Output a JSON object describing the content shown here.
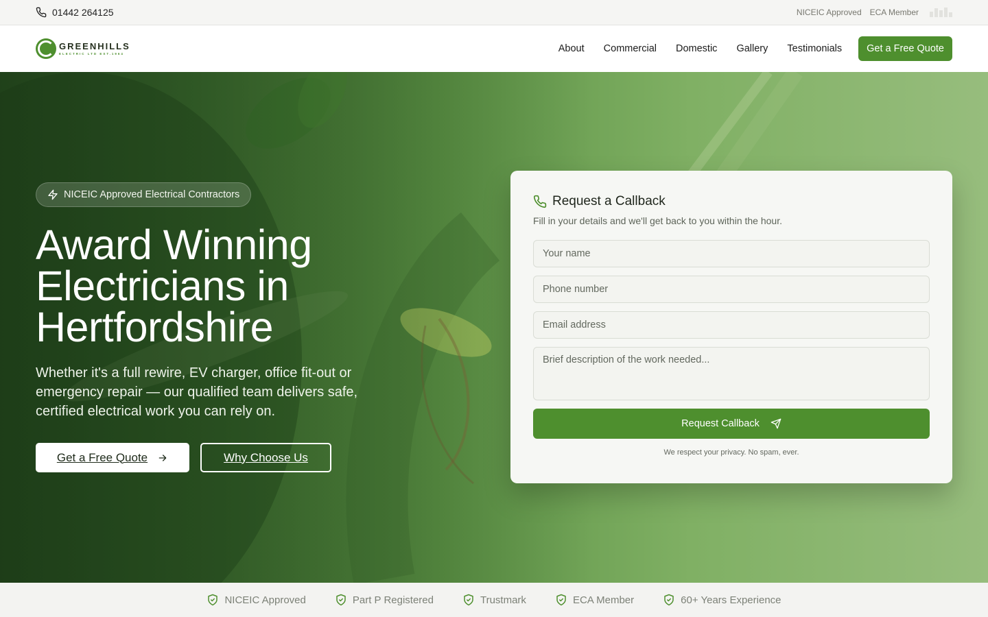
{
  "topbar": {
    "phone": "01442 264125",
    "badges": [
      "NICEIC Approved",
      "ECA Member"
    ]
  },
  "header": {
    "logo_name": "GREENHILLS",
    "logo_sub": "ELECTRIC LTD EST.1964",
    "nav": [
      "About",
      "Commercial",
      "Domestic",
      "Gallery",
      "Testimonials"
    ],
    "cta": "Get a Free Quote"
  },
  "hero": {
    "badge": "NICEIC Approved Electrical Contractors",
    "title_lines": [
      "Award Winning",
      "Electricians in",
      "Hertfordshire"
    ],
    "subtitle": "Whether it's a full rewire, EV charger, office fit-out or emergency repair — our qualified team delivers safe, certified electrical work you can rely on.",
    "primary_button": "Get a Free Quote",
    "secondary_button": "Why Choose Us"
  },
  "callback": {
    "title": "Request a Callback",
    "description": "Fill in your details and we'll get back to you within the hour.",
    "name_placeholder": "Your name",
    "phone_placeholder": "Phone number",
    "email_placeholder": "Email address",
    "message_placeholder": "Brief description of the work needed...",
    "submit": "Request Callback",
    "privacy": "We respect your privacy. No spam, ever."
  },
  "trust": [
    "NICEIC Approved",
    "Part P Registered",
    "Trustmark",
    "ECA Member",
    "60+ Years Experience"
  ],
  "colors": {
    "brand_green": "#4e8f2e",
    "hero_dark": "#2f5a24",
    "hero_light": "#97bd7d",
    "trust_text": "#7c8177"
  },
  "icons": {
    "phone": "phone-icon",
    "bolt": "lightning-icon",
    "arrow": "arrow-right-icon",
    "send": "send-icon",
    "shield": "shield-check-icon"
  }
}
